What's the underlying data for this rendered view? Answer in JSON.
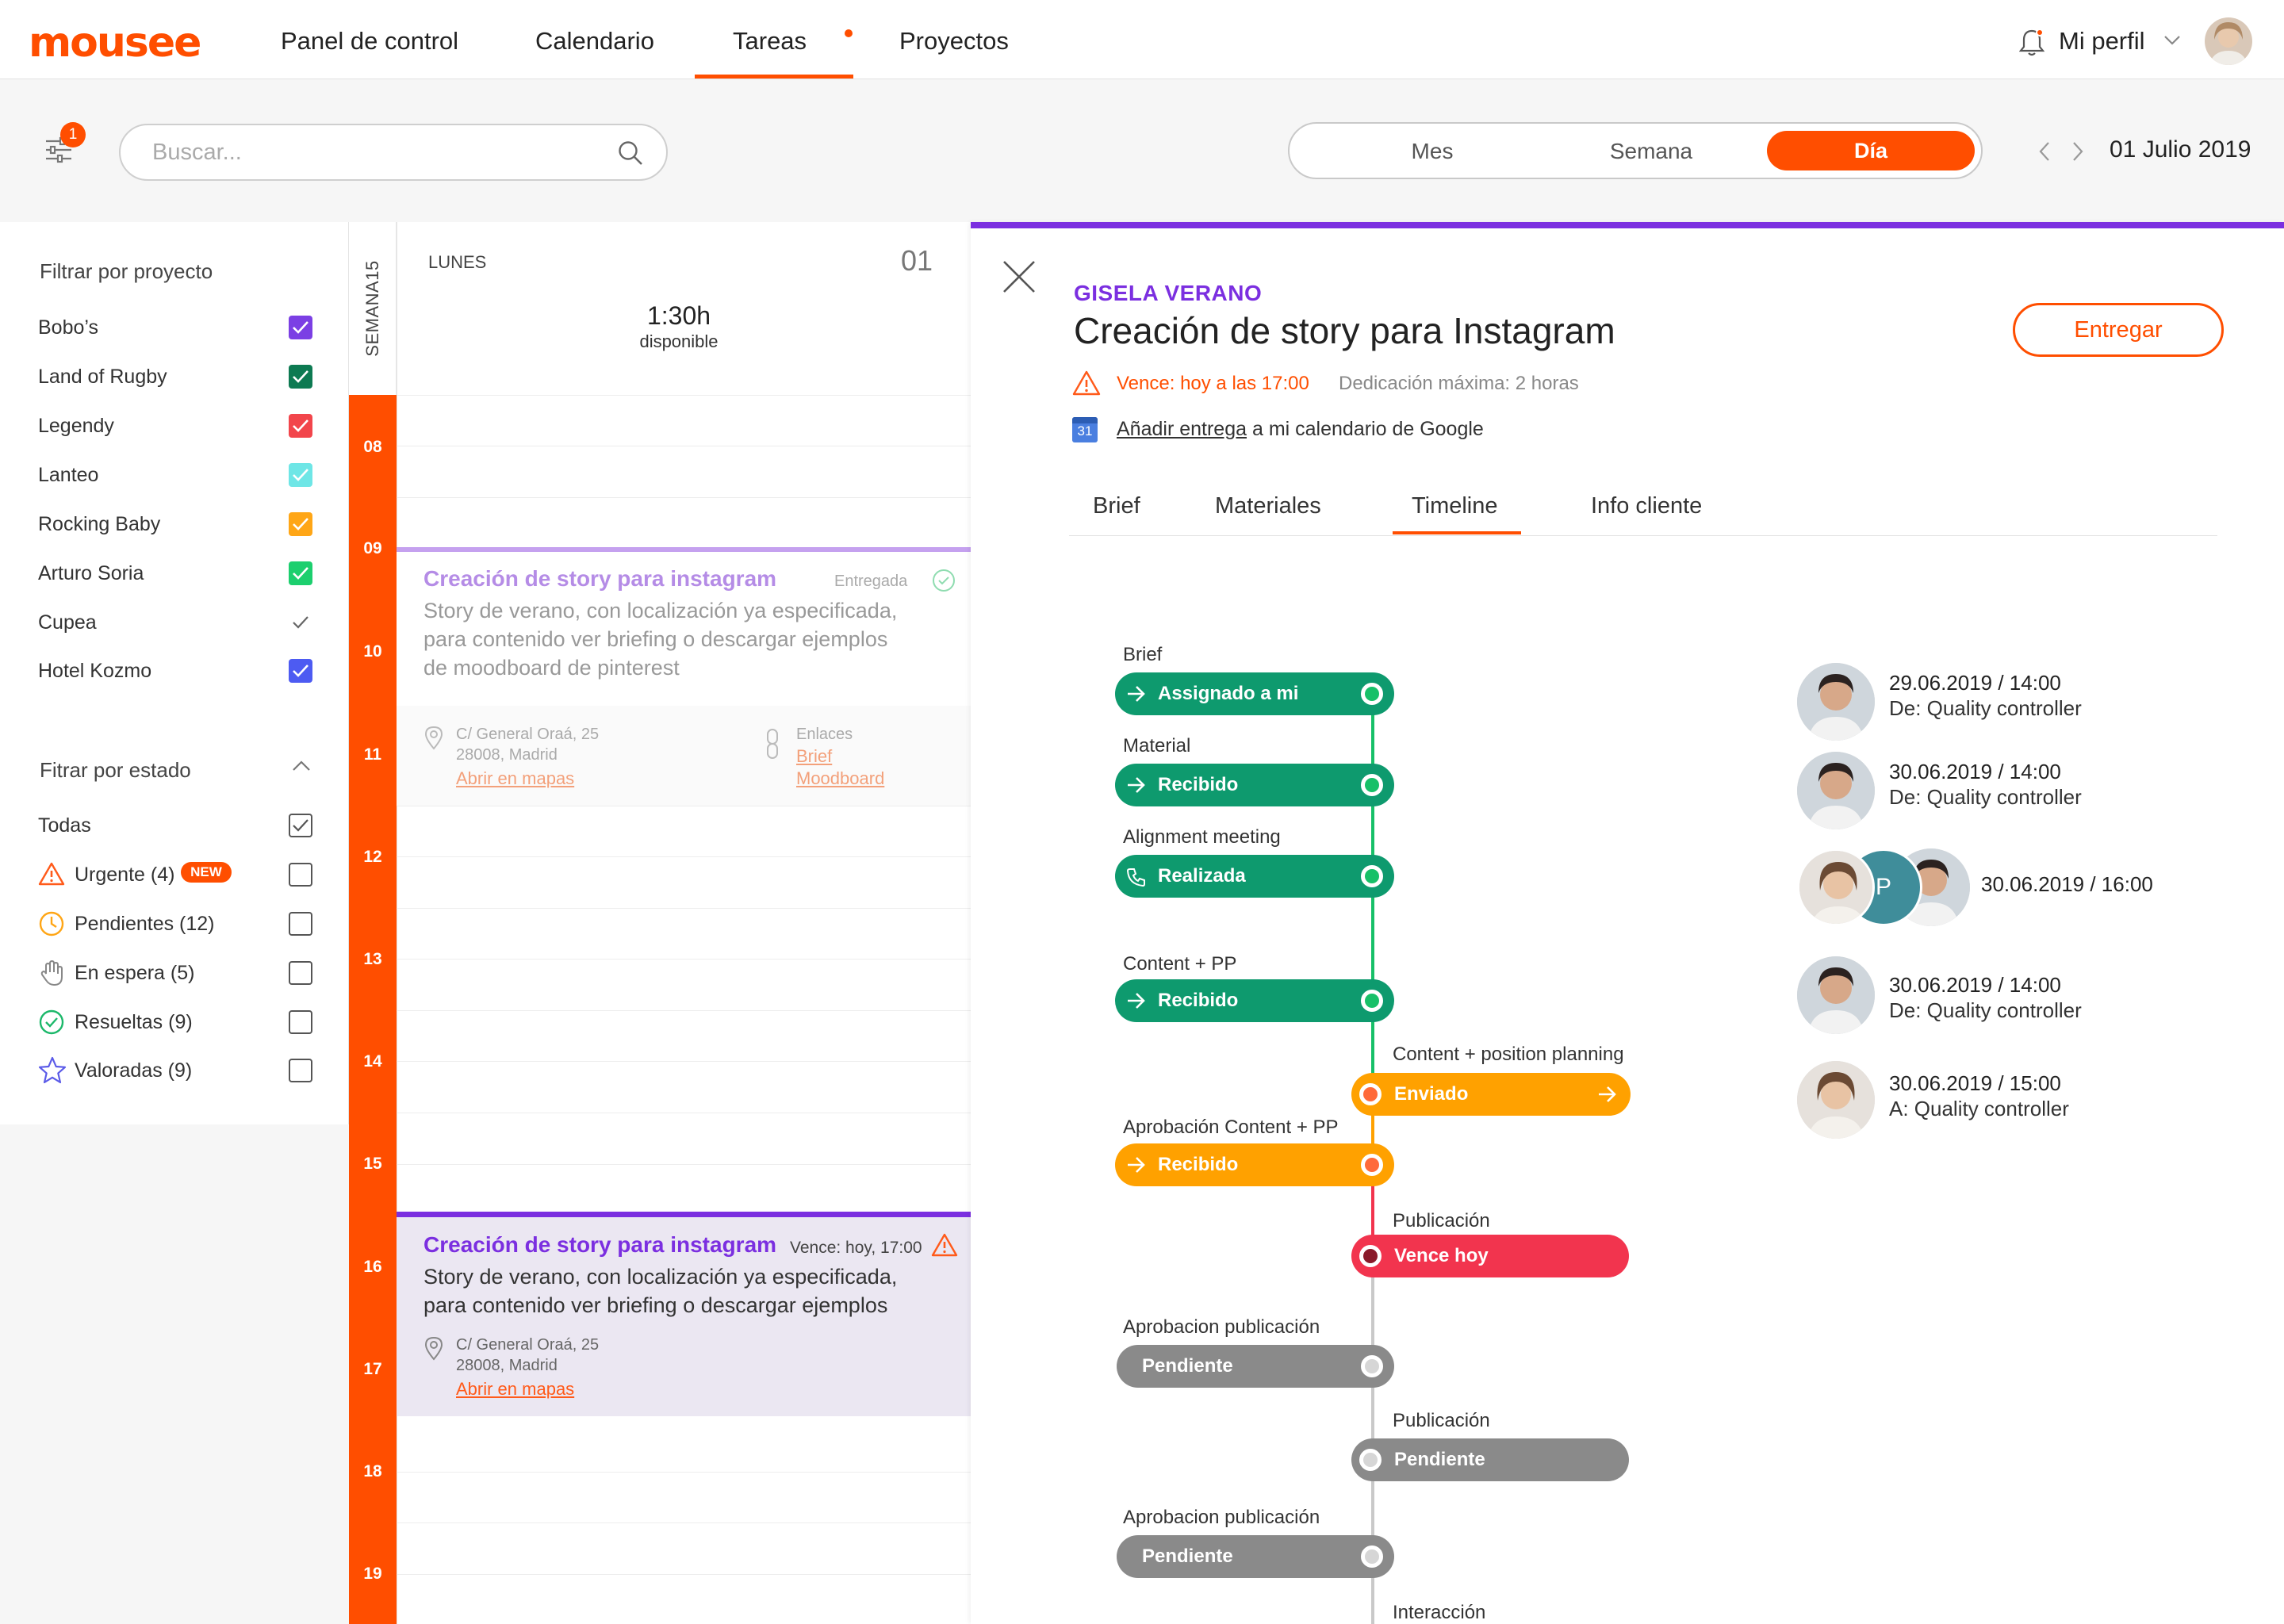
{
  "app": {
    "logo": "mousee"
  },
  "nav": {
    "items": [
      "Panel de control",
      "Calendario",
      "Tareas",
      "Proyectos"
    ],
    "profile": "Mi perfil"
  },
  "toolbar": {
    "filter_count": "1",
    "search_placeholder": "Buscar...",
    "views": [
      "Mes",
      "Semana",
      "Día"
    ],
    "active_view": "Día",
    "date": "01 Julio 2019"
  },
  "filters": {
    "project_title": "Filtrar por proyecto",
    "projects": [
      {
        "name": "Bobo’s",
        "color": "#7b3fe4",
        "checked": true
      },
      {
        "name": "Land of Rugby",
        "color": "#0d7a52",
        "checked": true
      },
      {
        "name": "Legendy",
        "color": "#f2454b",
        "checked": true
      },
      {
        "name": "Lanteo",
        "color": "#6ee6e6",
        "checked": true
      },
      {
        "name": "Rocking Baby",
        "color": "#ffa616",
        "checked": true
      },
      {
        "name": "Arturo Soria",
        "color": "#1ccf6e",
        "checked": true
      },
      {
        "name": "Cupea",
        "color": "#ffffff",
        "checked": true
      },
      {
        "name": "Hotel Kozmo",
        "color": "#4d5bf2",
        "checked": true
      }
    ],
    "status_title": "Fitrar por estado",
    "statuses": [
      {
        "label": "Todas",
        "icon": "none",
        "checked": true
      },
      {
        "label": "Urgente (4)",
        "icon": "warning-icon",
        "checked": false,
        "badge": "NEW"
      },
      {
        "label": "Pendientes (12)",
        "icon": "clock-icon",
        "checked": false
      },
      {
        "label": "En espera (5)",
        "icon": "hand-icon",
        "checked": false
      },
      {
        "label": "Resueltas (9)",
        "icon": "check-circle-icon",
        "checked": false
      },
      {
        "label": "Valoradas (9)",
        "icon": "star-icon",
        "checked": false
      }
    ]
  },
  "calendar": {
    "week": "SEMANA15",
    "day_name": "LUNES",
    "day_num": "01",
    "available_time": "1:30h",
    "available_label": "disponible",
    "hours": [
      "08",
      "09",
      "10",
      "11",
      "12",
      "13",
      "14",
      "15",
      "16",
      "17",
      "18",
      "19"
    ],
    "events": [
      {
        "title": "Creación de story para instagram",
        "status": "Entregada",
        "desc": "Story de verano, con localización ya especificada, para contenido ver briefing o descargar ejemplos de moodboard de pinterest",
        "address1": "C/ General Oraá, 25",
        "address2": "28008, Madrid",
        "map_link": "Abrir en mapas",
        "links_label": "Enlaces",
        "links": [
          "Brief",
          "Moodboard"
        ]
      },
      {
        "title": "Creación de story para instagram",
        "due": "Vence: hoy, 17:00",
        "desc": "Story de verano, con localización ya especificada, para contenido ver briefing o descargar ejemplos",
        "address1": "C/ General Oraá, 25",
        "address2": "28008, Madrid",
        "map_link": "Abrir en mapas"
      }
    ]
  },
  "detail": {
    "client": "GISELA VERANO",
    "title": "Creación de story para Instagram",
    "deliver_button": "Entregar",
    "due": "Vence: hoy a las 17:00",
    "dedication": "Dedicación máxima: 2 horas",
    "gcal_day": "31",
    "gcal_link": "Añadir entrega",
    "gcal_rest": "a mi calendario de Google",
    "tabs": [
      "Brief",
      "Materiales",
      "Timeline",
      "Info cliente"
    ],
    "active_tab": "Timeline",
    "timeline": [
      {
        "title": "Brief",
        "label": "Assignado a mi",
        "color": "#0e9a6e",
        "icon": "arrow-right-icon"
      },
      {
        "title": "Material",
        "label": "Recibido",
        "color": "#0e9a6e",
        "icon": "arrow-right-icon"
      },
      {
        "title": "Alignment meeting",
        "label": "Realizada",
        "color": "#0e9a6e",
        "icon": "phone-icon"
      },
      {
        "title": "Content + PP",
        "label": "Recibido",
        "color": "#0e9a6e",
        "icon": "arrow-right-icon"
      },
      {
        "title": "Content + position planning",
        "label": "Enviado",
        "color": "#ffa100",
        "icon": "arrow-right-icon"
      },
      {
        "title": "Aprobación Content + PP",
        "label": "Recibido",
        "color": "#ffa100",
        "icon": "arrow-right-icon"
      },
      {
        "title": "Publicación",
        "label": "Vence hoy",
        "color": "#f2344e",
        "icon": "none"
      },
      {
        "title": "Aprobacion publicación",
        "label": "Pendiente",
        "color": "#8a8a8a",
        "icon": "none"
      },
      {
        "title": "Publicación",
        "label": "Pendiente",
        "color": "#8a8a8a",
        "icon": "none"
      },
      {
        "title": "Aprobacion publicación",
        "label": "Pendiente",
        "color": "#8a8a8a",
        "icon": "none"
      },
      {
        "title": "Interacción",
        "label": "",
        "color": "#8a8a8a",
        "icon": "none"
      }
    ],
    "activity": [
      {
        "date": "29.06.2019 / 14:00",
        "who": "De: Quality controller"
      },
      {
        "date": "30.06.2019 / 14:00",
        "who": "De: Quality controller"
      },
      {
        "date": "30.06.2019 / 16:00",
        "who": "",
        "group_initial": "P"
      },
      {
        "date": "30.06.2019 / 14:00",
        "who": "De: Quality controller"
      },
      {
        "date": "30.06.2019 / 15:00",
        "who": "A: Quality controller"
      }
    ]
  }
}
